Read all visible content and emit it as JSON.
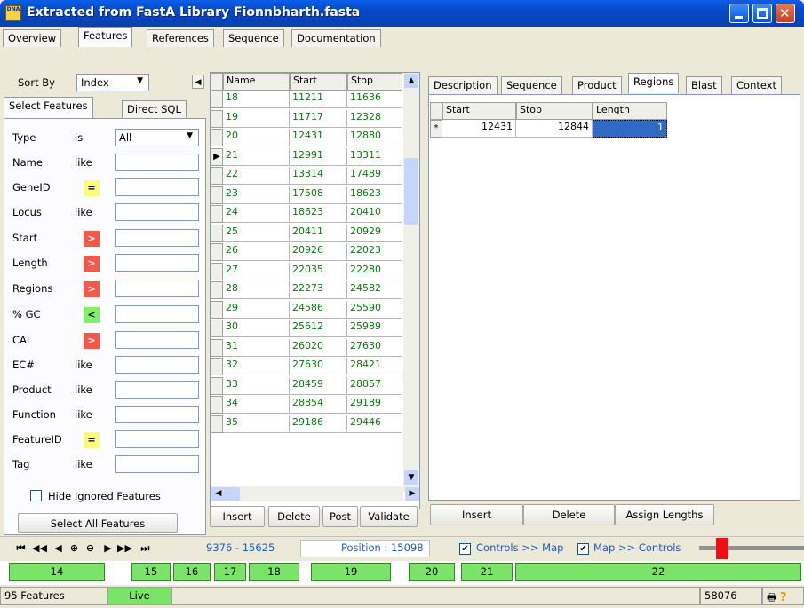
{
  "window": {
    "title": "Extracted from FastA Library Fionnbharth.fasta",
    "app_icon": "DNA"
  },
  "main_tabs": [
    "Overview",
    "Features",
    "References",
    "Sequence",
    "Documentation"
  ],
  "sort": {
    "label": "Sort By",
    "value": "Index"
  },
  "filter_tabs": [
    "Select Features",
    "Direct SQL"
  ],
  "filters": [
    {
      "label": "Type",
      "op": "is",
      "value": "All"
    },
    {
      "label": "Name",
      "op": "like"
    },
    {
      "label": "GeneID",
      "op": "="
    },
    {
      "label": "Locus",
      "op": "like"
    },
    {
      "label": "Start",
      "op": ">"
    },
    {
      "label": "Length",
      "op": ">"
    },
    {
      "label": "Regions",
      "op": ">"
    },
    {
      "label": "% GC",
      "op": "<"
    },
    {
      "label": "CAI",
      "op": ">"
    },
    {
      "label": "EC#",
      "op": "like"
    },
    {
      "label": "Product",
      "op": "like"
    },
    {
      "label": "Function",
      "op": "like"
    },
    {
      "label": "FeatureID",
      "op": "="
    },
    {
      "label": "Tag",
      "op": "like"
    }
  ],
  "hide_ignored": "Hide Ignored Features",
  "select_all": "Select All Features",
  "feature_grid": {
    "headers": [
      "Name",
      "Start",
      "Stop"
    ],
    "rows": [
      [
        "18",
        "11211",
        "11636"
      ],
      [
        "19",
        "11717",
        "12328"
      ],
      [
        "20",
        "12431",
        "12880"
      ],
      [
        "21",
        "12991",
        "13311"
      ],
      [
        "22",
        "13314",
        "17489"
      ],
      [
        "23",
        "17508",
        "18623"
      ],
      [
        "24",
        "18623",
        "20410"
      ],
      [
        "25",
        "20411",
        "20929"
      ],
      [
        "26",
        "20926",
        "22023"
      ],
      [
        "27",
        "22035",
        "22280"
      ],
      [
        "28",
        "22273",
        "24582"
      ],
      [
        "29",
        "24586",
        "25590"
      ],
      [
        "30",
        "25612",
        "25989"
      ],
      [
        "31",
        "26020",
        "27630"
      ],
      [
        "32",
        "27630",
        "28421"
      ],
      [
        "33",
        "28459",
        "28857"
      ],
      [
        "34",
        "28854",
        "29189"
      ],
      [
        "35",
        "29186",
        "29446"
      ]
    ],
    "buttons": [
      "Insert",
      "Delete",
      "Post",
      "Validate"
    ]
  },
  "detail_tabs": [
    "Description",
    "Sequence",
    "Product",
    "Regions",
    "Blast",
    "Context"
  ],
  "regions_grid": {
    "headers": [
      "Start",
      "Stop",
      "Length"
    ],
    "rows": [
      [
        "12431",
        "12844",
        "1"
      ]
    ],
    "row_marker": "*",
    "buttons": [
      "Insert",
      "Delete",
      "Assign Lengths"
    ]
  },
  "nav_bar": {
    "range": "9376 - 15625",
    "position": "Position : 15098",
    "controls_to_map": "Controls >> Map",
    "map_to_controls": "Map >> Controls"
  },
  "map_segments": [
    "14",
    "15",
    "16",
    "17",
    "18",
    "19",
    "20",
    "21",
    "22"
  ],
  "status": {
    "features": "95 Features",
    "mode": "Live",
    "count": "58076"
  },
  "colors": {
    "red_op": "#f3594a",
    "yellow_op": "#fbfb80",
    "green_op": "#7ef06a",
    "grid_text": "#0a7a0a",
    "map_green": "#7be36a"
  }
}
